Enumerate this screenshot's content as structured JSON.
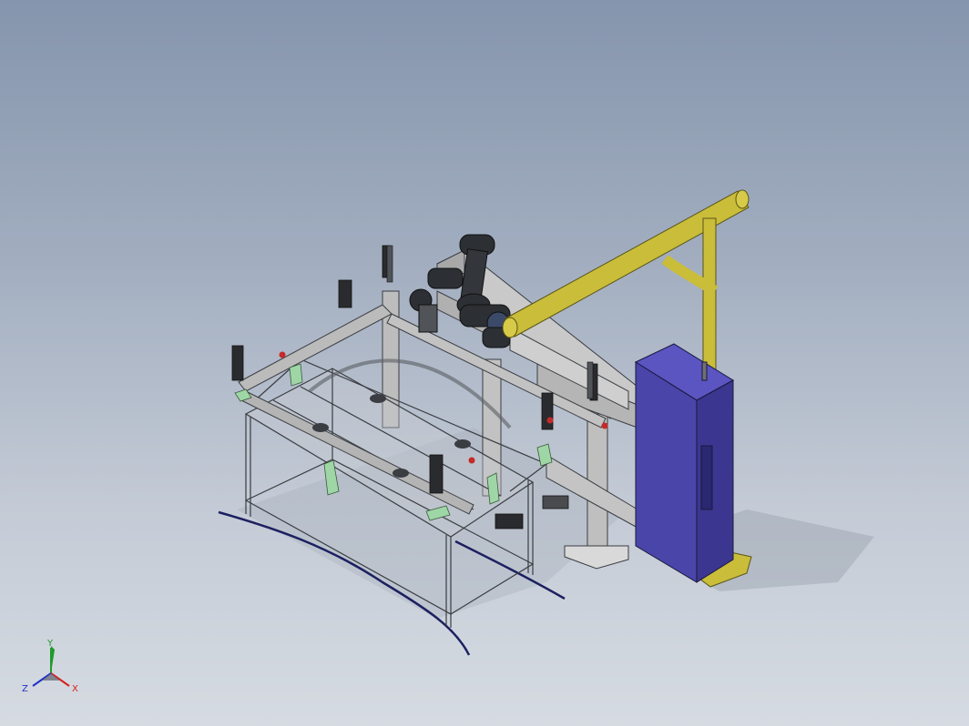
{
  "view": {
    "background_top": "#8595ad",
    "background_bottom": "#d6dbe2"
  },
  "triad": {
    "x_label": "X",
    "y_label": "Y",
    "z_label": "Z",
    "x_color": "#d62020",
    "y_color": "#1f9a2a",
    "z_color": "#2030c8"
  },
  "colors": {
    "frame": "#b8bcc2",
    "frame_edge": "#3a3d42",
    "gantry": "#c9c9c9",
    "robot": "#2c2f33",
    "jib": "#c9bd3a",
    "cabinet": "#4a45a8",
    "pad_green": "#9fd6a6"
  }
}
